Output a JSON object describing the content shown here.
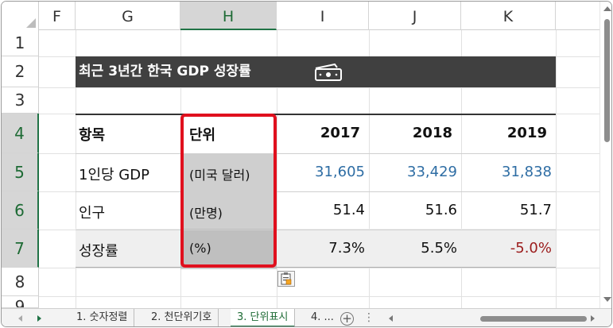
{
  "columns": [
    "F",
    "G",
    "H",
    "I",
    "J",
    "K"
  ],
  "rows": [
    "1",
    "2",
    "3",
    "4",
    "5",
    "6",
    "7",
    "8",
    "9"
  ],
  "selected_column": "H",
  "selected_rows": [
    "4",
    "5",
    "6",
    "7"
  ],
  "title": "최근 3년간 한국 GDP 성장률",
  "title_icon": "money-bill-icon",
  "table": {
    "headers": [
      "항목",
      "단위",
      "2017",
      "2018",
      "2019"
    ],
    "rows": [
      {
        "item": "1인당 GDP",
        "unit": "(미국 달러)",
        "v2017": "31,605",
        "v2018": "33,429",
        "v2019": "31,838"
      },
      {
        "item": "인구",
        "unit": "(만명)",
        "v2017": "51.4",
        "v2018": "51.6",
        "v2019": "51.7"
      },
      {
        "item": "성장률",
        "unit": "(%)",
        "v2017": "7.3%",
        "v2018": "5.5%",
        "v2019": "-5.0%"
      }
    ]
  },
  "colors": {
    "highlight_border": "#e0101e",
    "blue_numbers": "#2e6da4",
    "negative_number": "#9b1c1c",
    "accent": "#217346"
  },
  "sheet_tabs": {
    "tabs": [
      "1. 숫자정렬",
      "2. 천단위기호",
      "3. 단위표시",
      "4. ..."
    ],
    "active": "3. 단위표시",
    "add_label": "+"
  },
  "paste_icon": "paste-options-icon"
}
